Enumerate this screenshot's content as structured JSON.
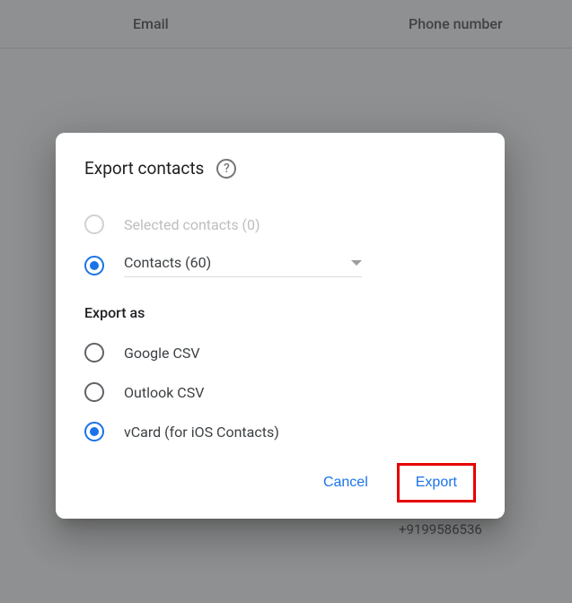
{
  "header": {
    "email": "Email",
    "phone": "Phone number"
  },
  "phones": [
    "+9199586536"
  ],
  "dialog": {
    "title": "Export contacts",
    "help_icon": "?",
    "selected_contacts_label": "Selected contacts (0)",
    "contacts_dropdown": "Contacts (60)",
    "export_as_header": "Export as",
    "formats": {
      "google_csv": "Google CSV",
      "outlook_csv": "Outlook CSV",
      "vcard": "vCard (for iOS Contacts)"
    },
    "actions": {
      "cancel": "Cancel",
      "export": "Export"
    }
  }
}
